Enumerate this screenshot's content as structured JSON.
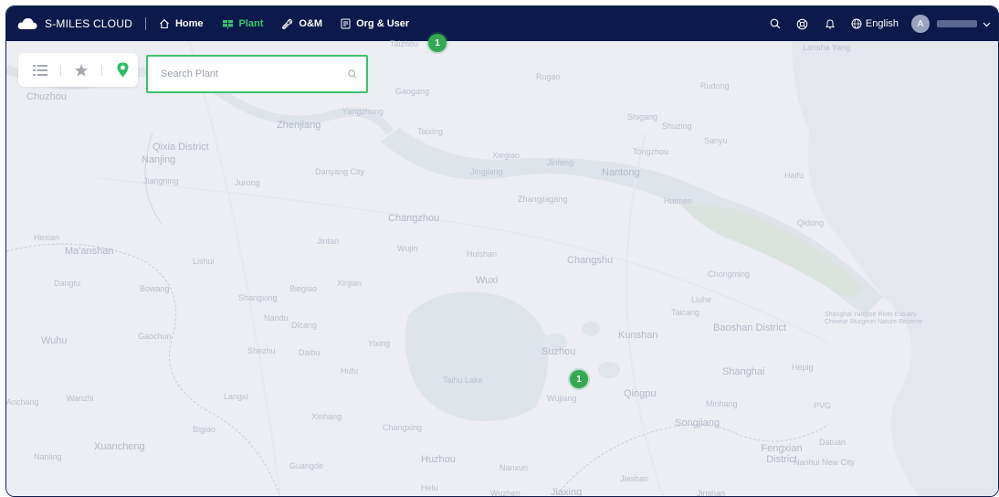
{
  "app": {
    "brand": "S-MILES CLOUD"
  },
  "nav": [
    {
      "label": "Home",
      "icon": "home-icon",
      "active": false
    },
    {
      "label": "Plant",
      "icon": "plant-icon",
      "active": true
    },
    {
      "label": "O&M",
      "icon": "wrench-icon",
      "active": false
    },
    {
      "label": "Org & User",
      "icon": "document-icon",
      "active": false
    }
  ],
  "header": {
    "language": "English",
    "avatar_initial": "A"
  },
  "search": {
    "placeholder": "Search Plant",
    "value": ""
  },
  "markers": [
    {
      "count": "1"
    },
    {
      "count": "1"
    }
  ],
  "map_labels": [
    "Lansha Yang",
    "Taizhou",
    "Chuzhou",
    "Rugao",
    "Rudong",
    "Gaogang",
    "Zhenjiang",
    "Yangzhong",
    "Taixing",
    "Shigang",
    "Shuzing",
    "Sanyu",
    "Qixia District",
    "Nanjing",
    "Jiangning",
    "Jurong",
    "Danyang City",
    "Jingjiang",
    "Xiegiao",
    "Jinfeng",
    "Nantong",
    "Tongzhou",
    "Haifu",
    "Zhangjiagang",
    "Haimen",
    "Qidong",
    "Changzhou",
    "Hexian",
    "Ma'anshan",
    "Jintan",
    "Wujin",
    "Huishan",
    "Changshu",
    "Lishui",
    "Dangtu",
    "Bowang",
    "Gaochun",
    "Shangxing",
    "Biegiao",
    "Xinjian",
    "Wuxi",
    "Taicang",
    "Liuhe",
    "Chongming",
    "Nandu",
    "Dicang",
    "Kunshan",
    "Baoshan District",
    "Shanghai Yangtze River Estuary Chinese Sturgeon Nature Reserve",
    "Wuhu",
    "Shezhu",
    "Daibu",
    "Yixing",
    "Suzhou",
    "Shanghai",
    "Hepig",
    "Hufu",
    "Taihu Lake",
    "Wujiang",
    "Qingpu",
    "Minhang",
    "PVG",
    "Wanzhi",
    "Langxi",
    "Xinhang",
    "Changxing",
    "Songjiang",
    "Bigiao",
    "Datuan",
    "Xuancheng",
    "Fengxian District",
    "Nanhui New City",
    "Nanling",
    "Guangde",
    "Huzhou",
    "Nanxun",
    "Jiashan",
    "Helu",
    "Wuzhen",
    "Jiaxing",
    "Jinshan",
    "Anchang"
  ],
  "colors": {
    "topbar": "#0b1a4a",
    "accent": "#39c56b",
    "marker": "#34a853",
    "map_bg": "#eceef3",
    "water": "#dfe3ea"
  }
}
